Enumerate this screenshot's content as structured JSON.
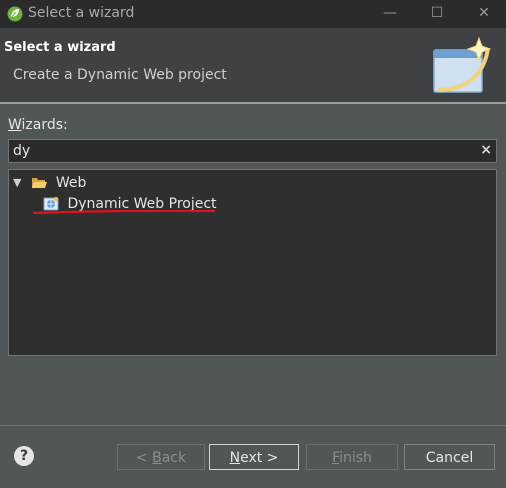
{
  "window": {
    "title": "Select a wizard",
    "icon": "spring-leaf-icon",
    "controls": [
      "minimize",
      "maximize",
      "close"
    ],
    "min_glyph": "—",
    "max_glyph": "☐",
    "close_glyph": "✕"
  },
  "header": {
    "title": "Select a wizard",
    "message": "Create a Dynamic Web project"
  },
  "wizards": {
    "label_mnemonic": "W",
    "label_rest": "izards:",
    "filter_value": "dy",
    "clear_glyph": "×"
  },
  "tree": {
    "web": {
      "label": "Web",
      "expanded": true
    },
    "dynamic_web_project": {
      "label": "Dynamic Web Project"
    }
  },
  "buttons": {
    "help": "?",
    "back_prefix": "< ",
    "back_mnemonic": "B",
    "back_rest": "ack",
    "next_mnemonic": "N",
    "next_rest": "ext >",
    "finish_mnemonic": "F",
    "finish_rest": "inish",
    "cancel": "Cancel"
  },
  "colors": {
    "background": "#515658",
    "header": "#3e4244",
    "titlebar": "#2b2b2b",
    "annotation_underline": "#e0121b"
  }
}
